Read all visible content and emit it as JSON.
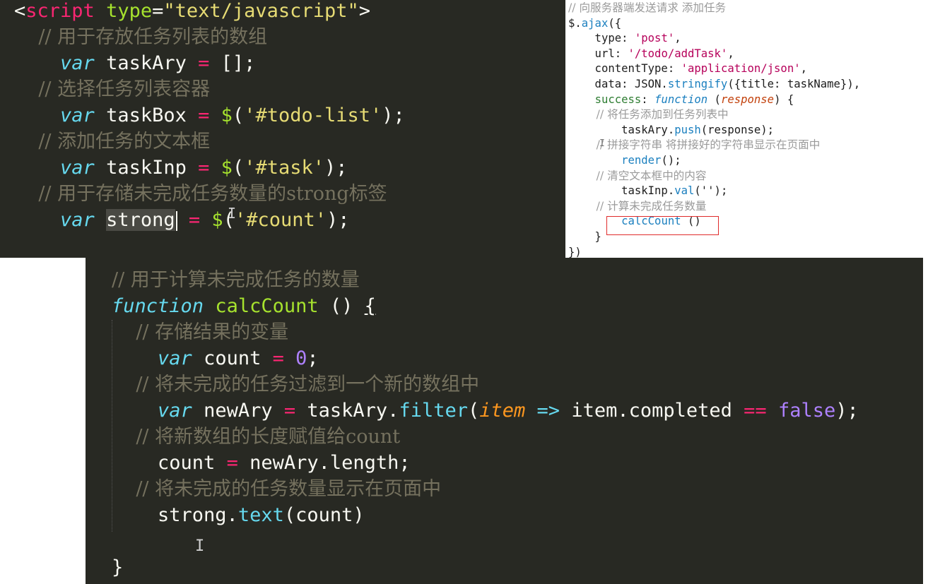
{
  "top_left": {
    "lines": [
      {
        "segments": [
          {
            "t": "<",
            "c": "pl"
          },
          {
            "t": "script",
            "c": "tag"
          },
          {
            "t": " ",
            "c": "pl"
          },
          {
            "t": "type",
            "c": "attr"
          },
          {
            "t": "=",
            "c": "pl"
          },
          {
            "t": "\"text/javascript\"",
            "c": "str"
          },
          {
            "t": ">",
            "c": "pl"
          }
        ]
      },
      {
        "segments": [
          {
            "t": "    // 用于存放任务列表的数组",
            "c": "cm"
          }
        ]
      },
      {
        "segments": [
          {
            "t": "    ",
            "c": "pl"
          },
          {
            "t": "var",
            "c": "kw"
          },
          {
            "t": " taskAry ",
            "c": "pl"
          },
          {
            "t": "=",
            "c": "op"
          },
          {
            "t": " [];",
            "c": "pl"
          }
        ]
      },
      {
        "segments": [
          {
            "t": "    // 选择任务列表容器",
            "c": "cm"
          }
        ]
      },
      {
        "segments": [
          {
            "t": "    ",
            "c": "pl"
          },
          {
            "t": "var",
            "c": "kw"
          },
          {
            "t": " taskBox ",
            "c": "pl"
          },
          {
            "t": "=",
            "c": "op"
          },
          {
            "t": " ",
            "c": "pl"
          },
          {
            "t": "$",
            "c": "fn"
          },
          {
            "t": "(",
            "c": "pl"
          },
          {
            "t": "'#todo-list'",
            "c": "str"
          },
          {
            "t": ");",
            "c": "pl"
          }
        ]
      },
      {
        "segments": [
          {
            "t": "    // 添加任务的文本框",
            "c": "cm"
          }
        ]
      },
      {
        "segments": [
          {
            "t": "    ",
            "c": "pl"
          },
          {
            "t": "var",
            "c": "kw"
          },
          {
            "t": " taskInp ",
            "c": "pl"
          },
          {
            "t": "=",
            "c": "op"
          },
          {
            "t": " ",
            "c": "pl"
          },
          {
            "t": "$",
            "c": "fn"
          },
          {
            "t": "(",
            "c": "pl"
          },
          {
            "t": "'#task'",
            "c": "str"
          },
          {
            "t": ");",
            "c": "pl"
          }
        ]
      },
      {
        "segments": [
          {
            "t": "    // 用于存储未完成任务数量的strong标签",
            "c": "cm"
          }
        ]
      },
      {
        "segments": [
          {
            "t": "    ",
            "c": "pl"
          },
          {
            "t": "var",
            "c": "kw"
          },
          {
            "t": " ",
            "c": "pl"
          },
          {
            "t": "strong",
            "c": "hl"
          },
          {
            "t": "",
            "c": "caret"
          },
          {
            "t": " ",
            "c": "pl"
          },
          {
            "t": "=",
            "c": "op"
          },
          {
            "t": " ",
            "c": "pl"
          },
          {
            "t": "$",
            "c": "fn"
          },
          {
            "t": "(",
            "c": "pl"
          },
          {
            "t": "'#count'",
            "c": "str"
          },
          {
            "t": ");",
            "c": "pl"
          }
        ]
      }
    ]
  },
  "top_right": {
    "lines": [
      {
        "segments": [
          {
            "t": "// 向服务器端发送请求 添加任务",
            "c": "cm"
          }
        ]
      },
      {
        "segments": [
          {
            "t": "$.",
            "c": "pl"
          },
          {
            "t": "ajax",
            "c": "fn"
          },
          {
            "t": "({",
            "c": "pl"
          }
        ]
      },
      {
        "segments": [
          {
            "t": "    type: ",
            "c": "pl"
          },
          {
            "t": "'post'",
            "c": "str"
          },
          {
            "t": ",",
            "c": "pl"
          }
        ]
      },
      {
        "segments": [
          {
            "t": "    url: ",
            "c": "pl"
          },
          {
            "t": "'/todo/addTask'",
            "c": "str"
          },
          {
            "t": ",",
            "c": "pl"
          }
        ]
      },
      {
        "segments": [
          {
            "t": "    contentType: ",
            "c": "pl"
          },
          {
            "t": "'application/json'",
            "c": "str"
          },
          {
            "t": ",",
            "c": "pl"
          }
        ]
      },
      {
        "segments": [
          {
            "t": "    data: JSON.",
            "c": "pl"
          },
          {
            "t": "stringify",
            "c": "fn"
          },
          {
            "t": "({title: taskName}),",
            "c": "pl"
          }
        ]
      },
      {
        "segments": [
          {
            "t": "    ",
            "c": "pl"
          },
          {
            "t": "success",
            "c": "key"
          },
          {
            "t": ": ",
            "c": "pl"
          },
          {
            "t": "function",
            "c": "kw"
          },
          {
            "t": " (",
            "c": "pl"
          },
          {
            "t": "response",
            "c": "par"
          },
          {
            "t": ") {",
            "c": "pl"
          }
        ]
      },
      {
        "segments": [
          {
            "t": "        // 将任务添加到任务列表中",
            "c": "cm"
          }
        ]
      },
      {
        "segments": [
          {
            "t": "        taskAry.",
            "c": "pl"
          },
          {
            "t": "push",
            "c": "fn"
          },
          {
            "t": "(response);",
            "c": "pl"
          }
        ]
      },
      {
        "segments": [
          {
            "t": "        // 拼接字符串 将拼接好的字符串显示在页面中",
            "c": "cm"
          }
        ]
      },
      {
        "segments": [
          {
            "t": "        ",
            "c": "pl"
          },
          {
            "t": "render",
            "c": "fn"
          },
          {
            "t": "();",
            "c": "pl"
          }
        ]
      },
      {
        "segments": [
          {
            "t": "        // 清空文本框中的内容",
            "c": "cm"
          }
        ]
      },
      {
        "segments": [
          {
            "t": "        taskInp.",
            "c": "pl"
          },
          {
            "t": "val",
            "c": "fn"
          },
          {
            "t": "('');",
            "c": "pl"
          }
        ]
      },
      {
        "segments": [
          {
            "t": "        // 计算未完成任务数量",
            "c": "cm"
          }
        ]
      },
      {
        "segments": [
          {
            "t": "        ",
            "c": "pl"
          },
          {
            "t": "calcCount",
            "c": "fn"
          },
          {
            "t": " ()",
            "c": "pl"
          }
        ]
      },
      {
        "segments": [
          {
            "t": "    }",
            "c": "pl"
          }
        ]
      },
      {
        "segments": [
          {
            "t": "})",
            "c": "pl"
          }
        ]
      }
    ]
  },
  "bottom": {
    "lines": [
      {
        "segments": [
          {
            "t": "// 用于计算未完成任务的数量",
            "c": "cm"
          }
        ]
      },
      {
        "segments": [
          {
            "t": "function",
            "c": "kw"
          },
          {
            "t": " ",
            "c": "pl"
          },
          {
            "t": "calcCount",
            "c": "fn"
          },
          {
            "t": " () ",
            "c": "pl"
          },
          {
            "t": "{",
            "c": "underline"
          }
        ]
      },
      {
        "segments": [
          {
            "t": "    // 存储结果的变量",
            "c": "cm"
          }
        ]
      },
      {
        "segments": [
          {
            "t": "    ",
            "c": "pl"
          },
          {
            "t": "var",
            "c": "kw"
          },
          {
            "t": " count ",
            "c": "pl"
          },
          {
            "t": "=",
            "c": "op"
          },
          {
            "t": " ",
            "c": "pl"
          },
          {
            "t": "0",
            "c": "num"
          },
          {
            "t": ";",
            "c": "pl"
          }
        ]
      },
      {
        "segments": [
          {
            "t": "    // 将未完成的任务过滤到一个新的数组中",
            "c": "cm"
          }
        ]
      },
      {
        "segments": [
          {
            "t": "    ",
            "c": "pl"
          },
          {
            "t": "var",
            "c": "kw"
          },
          {
            "t": " newAry ",
            "c": "pl"
          },
          {
            "t": "=",
            "c": "op"
          },
          {
            "t": " taskAry.",
            "c": "pl"
          },
          {
            "t": "filter",
            "c": "meth"
          },
          {
            "t": "(",
            "c": "pl"
          },
          {
            "t": "item",
            "c": "par"
          },
          {
            "t": " ",
            "c": "pl"
          },
          {
            "t": "=>",
            "c": "kw"
          },
          {
            "t": " item.completed ",
            "c": "pl"
          },
          {
            "t": "==",
            "c": "op"
          },
          {
            "t": " ",
            "c": "pl"
          },
          {
            "t": "false",
            "c": "bool"
          },
          {
            "t": ");",
            "c": "pl"
          }
        ]
      },
      {
        "segments": [
          {
            "t": "    // 将新数组的长度赋值给count",
            "c": "cm"
          }
        ]
      },
      {
        "segments": [
          {
            "t": "    count ",
            "c": "pl"
          },
          {
            "t": "=",
            "c": "op"
          },
          {
            "t": " newAry.length;",
            "c": "pl"
          }
        ]
      },
      {
        "segments": [
          {
            "t": "    // 将未完成的任务数量显示在页面中",
            "c": "cm"
          }
        ]
      },
      {
        "segments": [
          {
            "t": "    strong.",
            "c": "pl"
          },
          {
            "t": "text",
            "c": "meth"
          },
          {
            "t": "(count)",
            "c": "pl"
          }
        ]
      },
      {
        "segments": [
          {
            "t": "",
            "c": "pl"
          }
        ]
      },
      {
        "segments": [
          {
            "t": "}",
            "c": "pl"
          }
        ]
      }
    ]
  },
  "ibeam_glyph": "I"
}
